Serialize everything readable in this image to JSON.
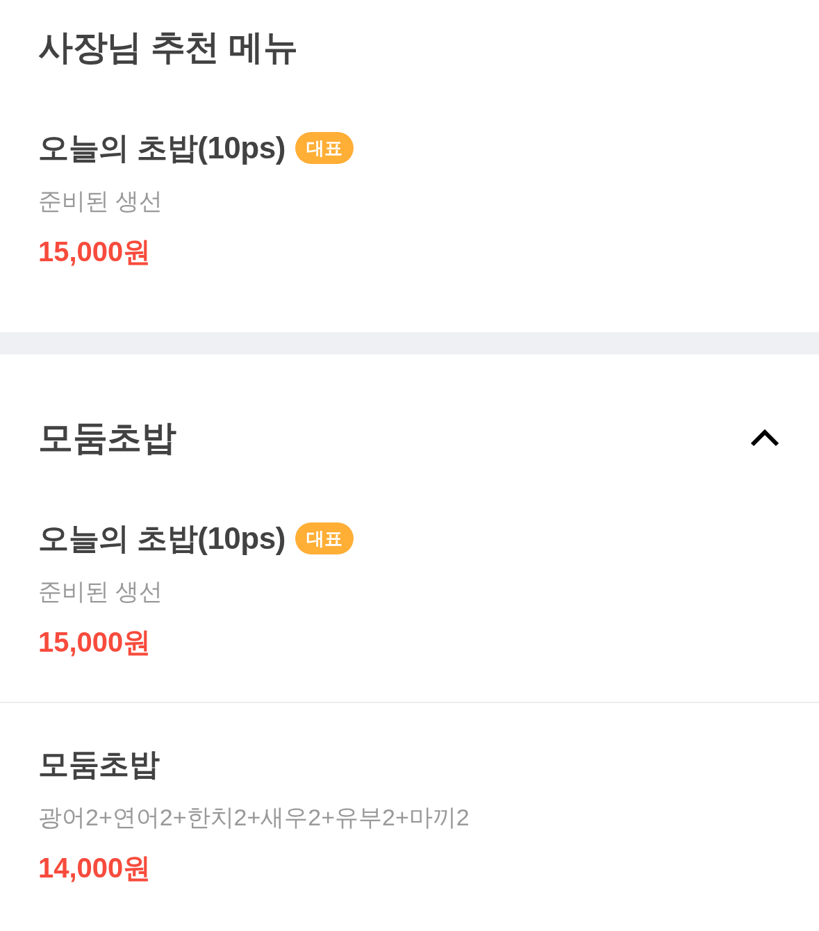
{
  "sections": [
    {
      "title": "사장님 추천 메뉴",
      "items": [
        {
          "name": "오늘의 초밥(10ps)",
          "badge": "대표",
          "description": "준비된 생선",
          "price": "15,000원"
        }
      ]
    },
    {
      "title": "모둠초밥",
      "expanded": true,
      "items": [
        {
          "name": "오늘의 초밥(10ps)",
          "badge": "대표",
          "description": "준비된 생선",
          "price": "15,000원"
        },
        {
          "name": "모둠초밥",
          "description": "광어2+연어2+한치2+새우2+유부2+마끼2",
          "price": "14,000원"
        }
      ]
    }
  ]
}
